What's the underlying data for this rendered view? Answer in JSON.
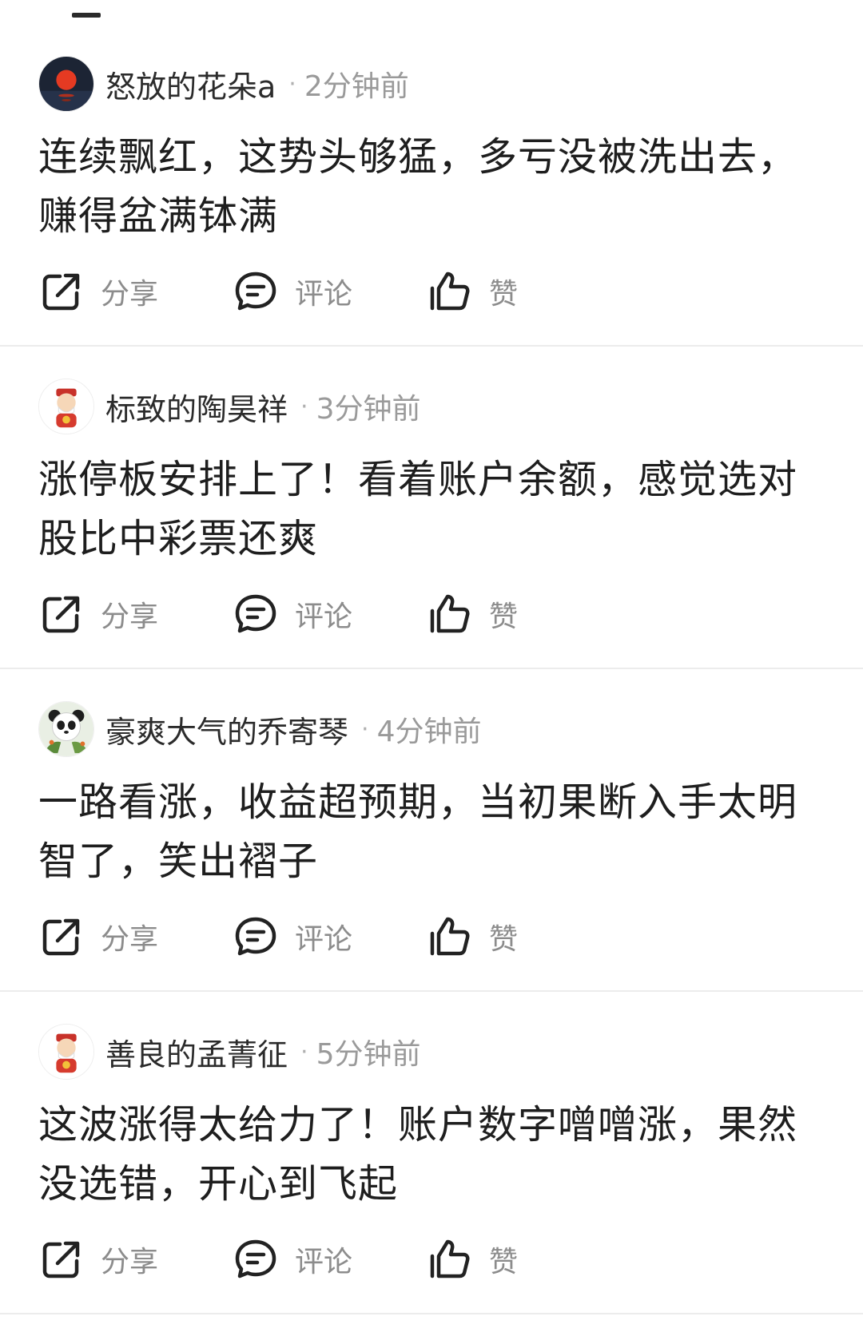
{
  "posts": [
    {
      "username": "怒放的花朵a",
      "separator": "·",
      "time": "2分钟前",
      "avatar_icon": "red-sun-avatar-icon",
      "text": "连续飘红，这势头够猛，多亏没被洗出去，赚得盆满钵满",
      "actions": {
        "share": "分享",
        "comment": "评论",
        "like": "赞"
      }
    },
    {
      "username": "标致的陶昊祥",
      "separator": "·",
      "time": "3分钟前",
      "avatar_icon": "cartoon-fortune-god-avatar-icon",
      "text": "涨停板安排上了！看着账户余额，感觉选对股比中彩票还爽",
      "actions": {
        "share": "分享",
        "comment": "评论",
        "like": "赞"
      }
    },
    {
      "username": "豪爽大气的乔寄琴",
      "separator": "·",
      "time": "4分钟前",
      "avatar_icon": "panda-avatar-icon",
      "text": "一路看涨，收益超预期，当初果断入手太明智了，笑出褶子",
      "actions": {
        "share": "分享",
        "comment": "评论",
        "like": "赞"
      }
    },
    {
      "username": "善良的孟菁征",
      "separator": "·",
      "time": "5分钟前",
      "avatar_icon": "cartoon-fortune-god-avatar-icon",
      "text": "这波涨得太给力了！账户数字噌噌涨，果然没选错，开心到飞起",
      "actions": {
        "share": "分享",
        "comment": "评论",
        "like": "赞"
      }
    }
  ],
  "colors": {
    "text": "#1e1e1e",
    "muted": "#9a9a9a",
    "divider": "#ececec",
    "icon": "#222222"
  }
}
